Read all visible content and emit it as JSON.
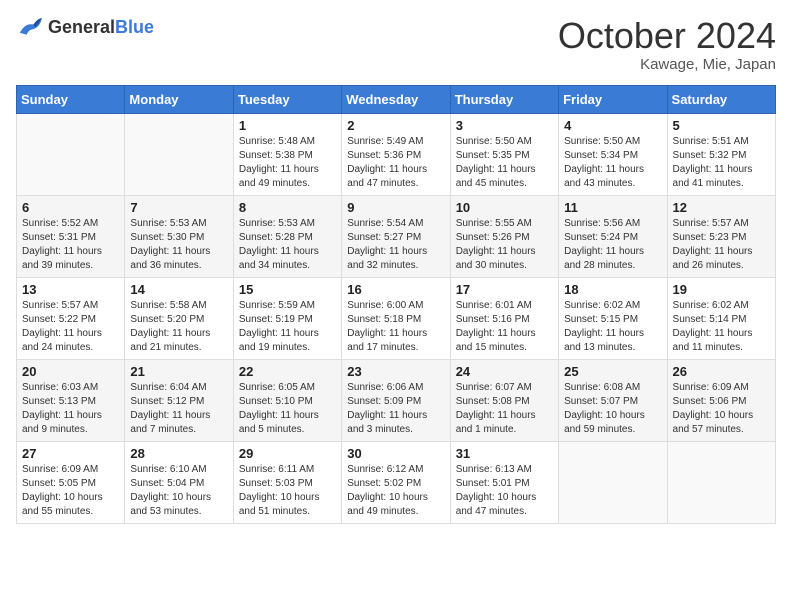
{
  "header": {
    "logo_general": "General",
    "logo_blue": "Blue",
    "month_year": "October 2024",
    "location": "Kawage, Mie, Japan"
  },
  "weekdays": [
    "Sunday",
    "Monday",
    "Tuesday",
    "Wednesday",
    "Thursday",
    "Friday",
    "Saturday"
  ],
  "weeks": [
    [
      {
        "day": "",
        "sunrise": "",
        "sunset": "",
        "daylight": ""
      },
      {
        "day": "",
        "sunrise": "",
        "sunset": "",
        "daylight": ""
      },
      {
        "day": "1",
        "sunrise": "Sunrise: 5:48 AM",
        "sunset": "Sunset: 5:38 PM",
        "daylight": "Daylight: 11 hours and 49 minutes."
      },
      {
        "day": "2",
        "sunrise": "Sunrise: 5:49 AM",
        "sunset": "Sunset: 5:36 PM",
        "daylight": "Daylight: 11 hours and 47 minutes."
      },
      {
        "day": "3",
        "sunrise": "Sunrise: 5:50 AM",
        "sunset": "Sunset: 5:35 PM",
        "daylight": "Daylight: 11 hours and 45 minutes."
      },
      {
        "day": "4",
        "sunrise": "Sunrise: 5:50 AM",
        "sunset": "Sunset: 5:34 PM",
        "daylight": "Daylight: 11 hours and 43 minutes."
      },
      {
        "day": "5",
        "sunrise": "Sunrise: 5:51 AM",
        "sunset": "Sunset: 5:32 PM",
        "daylight": "Daylight: 11 hours and 41 minutes."
      }
    ],
    [
      {
        "day": "6",
        "sunrise": "Sunrise: 5:52 AM",
        "sunset": "Sunset: 5:31 PM",
        "daylight": "Daylight: 11 hours and 39 minutes."
      },
      {
        "day": "7",
        "sunrise": "Sunrise: 5:53 AM",
        "sunset": "Sunset: 5:30 PM",
        "daylight": "Daylight: 11 hours and 36 minutes."
      },
      {
        "day": "8",
        "sunrise": "Sunrise: 5:53 AM",
        "sunset": "Sunset: 5:28 PM",
        "daylight": "Daylight: 11 hours and 34 minutes."
      },
      {
        "day": "9",
        "sunrise": "Sunrise: 5:54 AM",
        "sunset": "Sunset: 5:27 PM",
        "daylight": "Daylight: 11 hours and 32 minutes."
      },
      {
        "day": "10",
        "sunrise": "Sunrise: 5:55 AM",
        "sunset": "Sunset: 5:26 PM",
        "daylight": "Daylight: 11 hours and 30 minutes."
      },
      {
        "day": "11",
        "sunrise": "Sunrise: 5:56 AM",
        "sunset": "Sunset: 5:24 PM",
        "daylight": "Daylight: 11 hours and 28 minutes."
      },
      {
        "day": "12",
        "sunrise": "Sunrise: 5:57 AM",
        "sunset": "Sunset: 5:23 PM",
        "daylight": "Daylight: 11 hours and 26 minutes."
      }
    ],
    [
      {
        "day": "13",
        "sunrise": "Sunrise: 5:57 AM",
        "sunset": "Sunset: 5:22 PM",
        "daylight": "Daylight: 11 hours and 24 minutes."
      },
      {
        "day": "14",
        "sunrise": "Sunrise: 5:58 AM",
        "sunset": "Sunset: 5:20 PM",
        "daylight": "Daylight: 11 hours and 21 minutes."
      },
      {
        "day": "15",
        "sunrise": "Sunrise: 5:59 AM",
        "sunset": "Sunset: 5:19 PM",
        "daylight": "Daylight: 11 hours and 19 minutes."
      },
      {
        "day": "16",
        "sunrise": "Sunrise: 6:00 AM",
        "sunset": "Sunset: 5:18 PM",
        "daylight": "Daylight: 11 hours and 17 minutes."
      },
      {
        "day": "17",
        "sunrise": "Sunrise: 6:01 AM",
        "sunset": "Sunset: 5:16 PM",
        "daylight": "Daylight: 11 hours and 15 minutes."
      },
      {
        "day": "18",
        "sunrise": "Sunrise: 6:02 AM",
        "sunset": "Sunset: 5:15 PM",
        "daylight": "Daylight: 11 hours and 13 minutes."
      },
      {
        "day": "19",
        "sunrise": "Sunrise: 6:02 AM",
        "sunset": "Sunset: 5:14 PM",
        "daylight": "Daylight: 11 hours and 11 minutes."
      }
    ],
    [
      {
        "day": "20",
        "sunrise": "Sunrise: 6:03 AM",
        "sunset": "Sunset: 5:13 PM",
        "daylight": "Daylight: 11 hours and 9 minutes."
      },
      {
        "day": "21",
        "sunrise": "Sunrise: 6:04 AM",
        "sunset": "Sunset: 5:12 PM",
        "daylight": "Daylight: 11 hours and 7 minutes."
      },
      {
        "day": "22",
        "sunrise": "Sunrise: 6:05 AM",
        "sunset": "Sunset: 5:10 PM",
        "daylight": "Daylight: 11 hours and 5 minutes."
      },
      {
        "day": "23",
        "sunrise": "Sunrise: 6:06 AM",
        "sunset": "Sunset: 5:09 PM",
        "daylight": "Daylight: 11 hours and 3 minutes."
      },
      {
        "day": "24",
        "sunrise": "Sunrise: 6:07 AM",
        "sunset": "Sunset: 5:08 PM",
        "daylight": "Daylight: 11 hours and 1 minute."
      },
      {
        "day": "25",
        "sunrise": "Sunrise: 6:08 AM",
        "sunset": "Sunset: 5:07 PM",
        "daylight": "Daylight: 10 hours and 59 minutes."
      },
      {
        "day": "26",
        "sunrise": "Sunrise: 6:09 AM",
        "sunset": "Sunset: 5:06 PM",
        "daylight": "Daylight: 10 hours and 57 minutes."
      }
    ],
    [
      {
        "day": "27",
        "sunrise": "Sunrise: 6:09 AM",
        "sunset": "Sunset: 5:05 PM",
        "daylight": "Daylight: 10 hours and 55 minutes."
      },
      {
        "day": "28",
        "sunrise": "Sunrise: 6:10 AM",
        "sunset": "Sunset: 5:04 PM",
        "daylight": "Daylight: 10 hours and 53 minutes."
      },
      {
        "day": "29",
        "sunrise": "Sunrise: 6:11 AM",
        "sunset": "Sunset: 5:03 PM",
        "daylight": "Daylight: 10 hours and 51 minutes."
      },
      {
        "day": "30",
        "sunrise": "Sunrise: 6:12 AM",
        "sunset": "Sunset: 5:02 PM",
        "daylight": "Daylight: 10 hours and 49 minutes."
      },
      {
        "day": "31",
        "sunrise": "Sunrise: 6:13 AM",
        "sunset": "Sunset: 5:01 PM",
        "daylight": "Daylight: 10 hours and 47 minutes."
      },
      {
        "day": "",
        "sunrise": "",
        "sunset": "",
        "daylight": ""
      },
      {
        "day": "",
        "sunrise": "",
        "sunset": "",
        "daylight": ""
      }
    ]
  ]
}
